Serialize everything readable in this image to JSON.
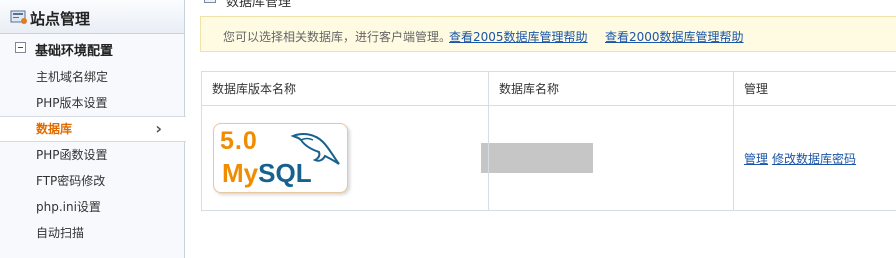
{
  "sidebar": {
    "title": "站点管理",
    "group": "基础环境配置",
    "items": [
      {
        "label": "主机域名绑定",
        "active": false
      },
      {
        "label": "PHP版本设置",
        "active": false
      },
      {
        "label": "数据库",
        "active": true
      },
      {
        "label": "PHP函数设置",
        "active": false
      },
      {
        "label": "FTP密码修改",
        "active": false
      },
      {
        "label": "php.ini设置",
        "active": false
      },
      {
        "label": "自动扫描",
        "active": false
      }
    ],
    "active_chevron": "›"
  },
  "main": {
    "page_title": "数据库管理",
    "notice": {
      "text": "您可以选择相关数据库，进行客户端管理。",
      "link_2005": "查看2005数据库管理帮助",
      "link_2000": "查看2000数据库管理帮助"
    },
    "table": {
      "headers": [
        "数据库版本名称",
        "数据库名称",
        "管理"
      ],
      "row": {
        "logo_version": "5.0",
        "logo_word_my": "My",
        "logo_word_sql": "SQL",
        "actions": [
          "管理",
          "修改数据库密码"
        ]
      }
    }
  },
  "colors": {
    "accent_orange": "#e06c00",
    "link_blue": "#1a55a8",
    "notice_bg": "#fffbe3"
  }
}
